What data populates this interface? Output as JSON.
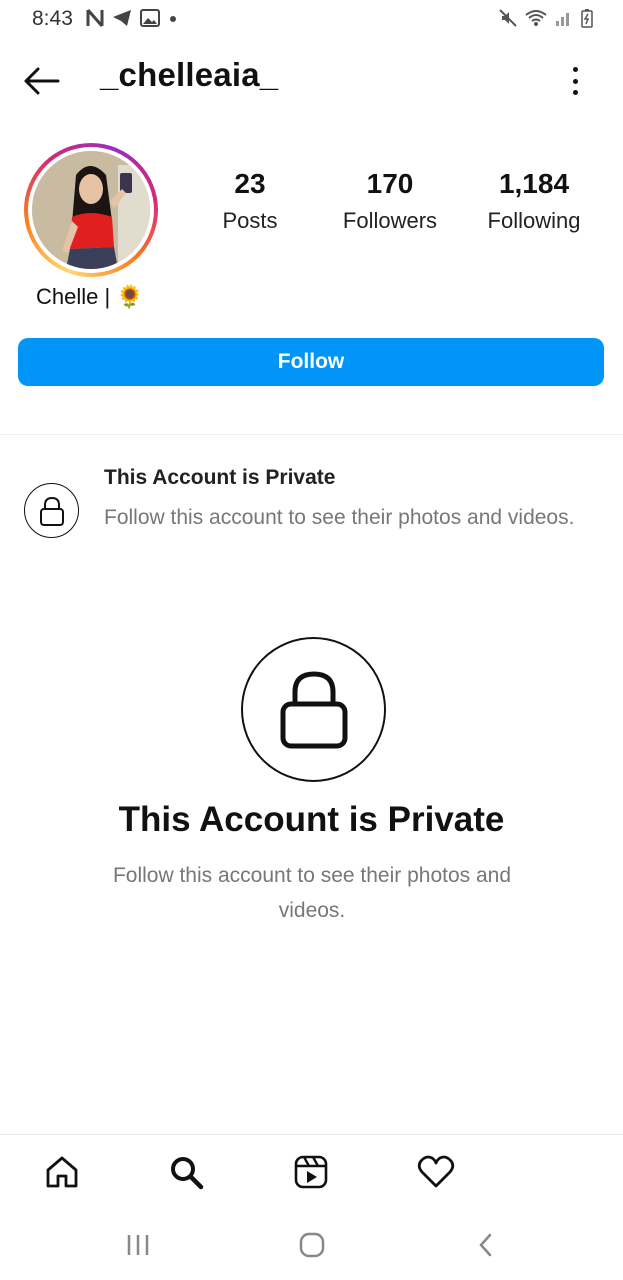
{
  "status_bar": {
    "time": "8:43",
    "left_icons": [
      "netflix-n-icon",
      "telegram-icon",
      "gallery-icon",
      "dot-icon"
    ],
    "right_icons": [
      "mute-icon",
      "wifi-icon",
      "signal-icon",
      "battery-icon"
    ]
  },
  "header": {
    "username": "_chelleaia_"
  },
  "profile": {
    "display_name": "Chelle |",
    "emoji": "🌻",
    "stats": [
      {
        "value": "23",
        "label": "Posts"
      },
      {
        "value": "170",
        "label": "Followers"
      },
      {
        "value": "1,184",
        "label": "Following"
      }
    ],
    "follow_label": "Follow"
  },
  "private_banner": {
    "title": "This Account is Private",
    "description": "Follow this account to see their photos and videos."
  },
  "private_center": {
    "title": "This Account is Private",
    "description": "Follow this account to see their photos and videos."
  },
  "bottom_nav": [
    "home-icon",
    "search-icon",
    "reels-icon",
    "heart-icon"
  ],
  "system_nav": [
    "recent-apps-icon",
    "home-circle-icon",
    "back-chevron-icon"
  ],
  "colors": {
    "accent": "#0095f6",
    "text": "#111111",
    "muted": "#777777"
  }
}
